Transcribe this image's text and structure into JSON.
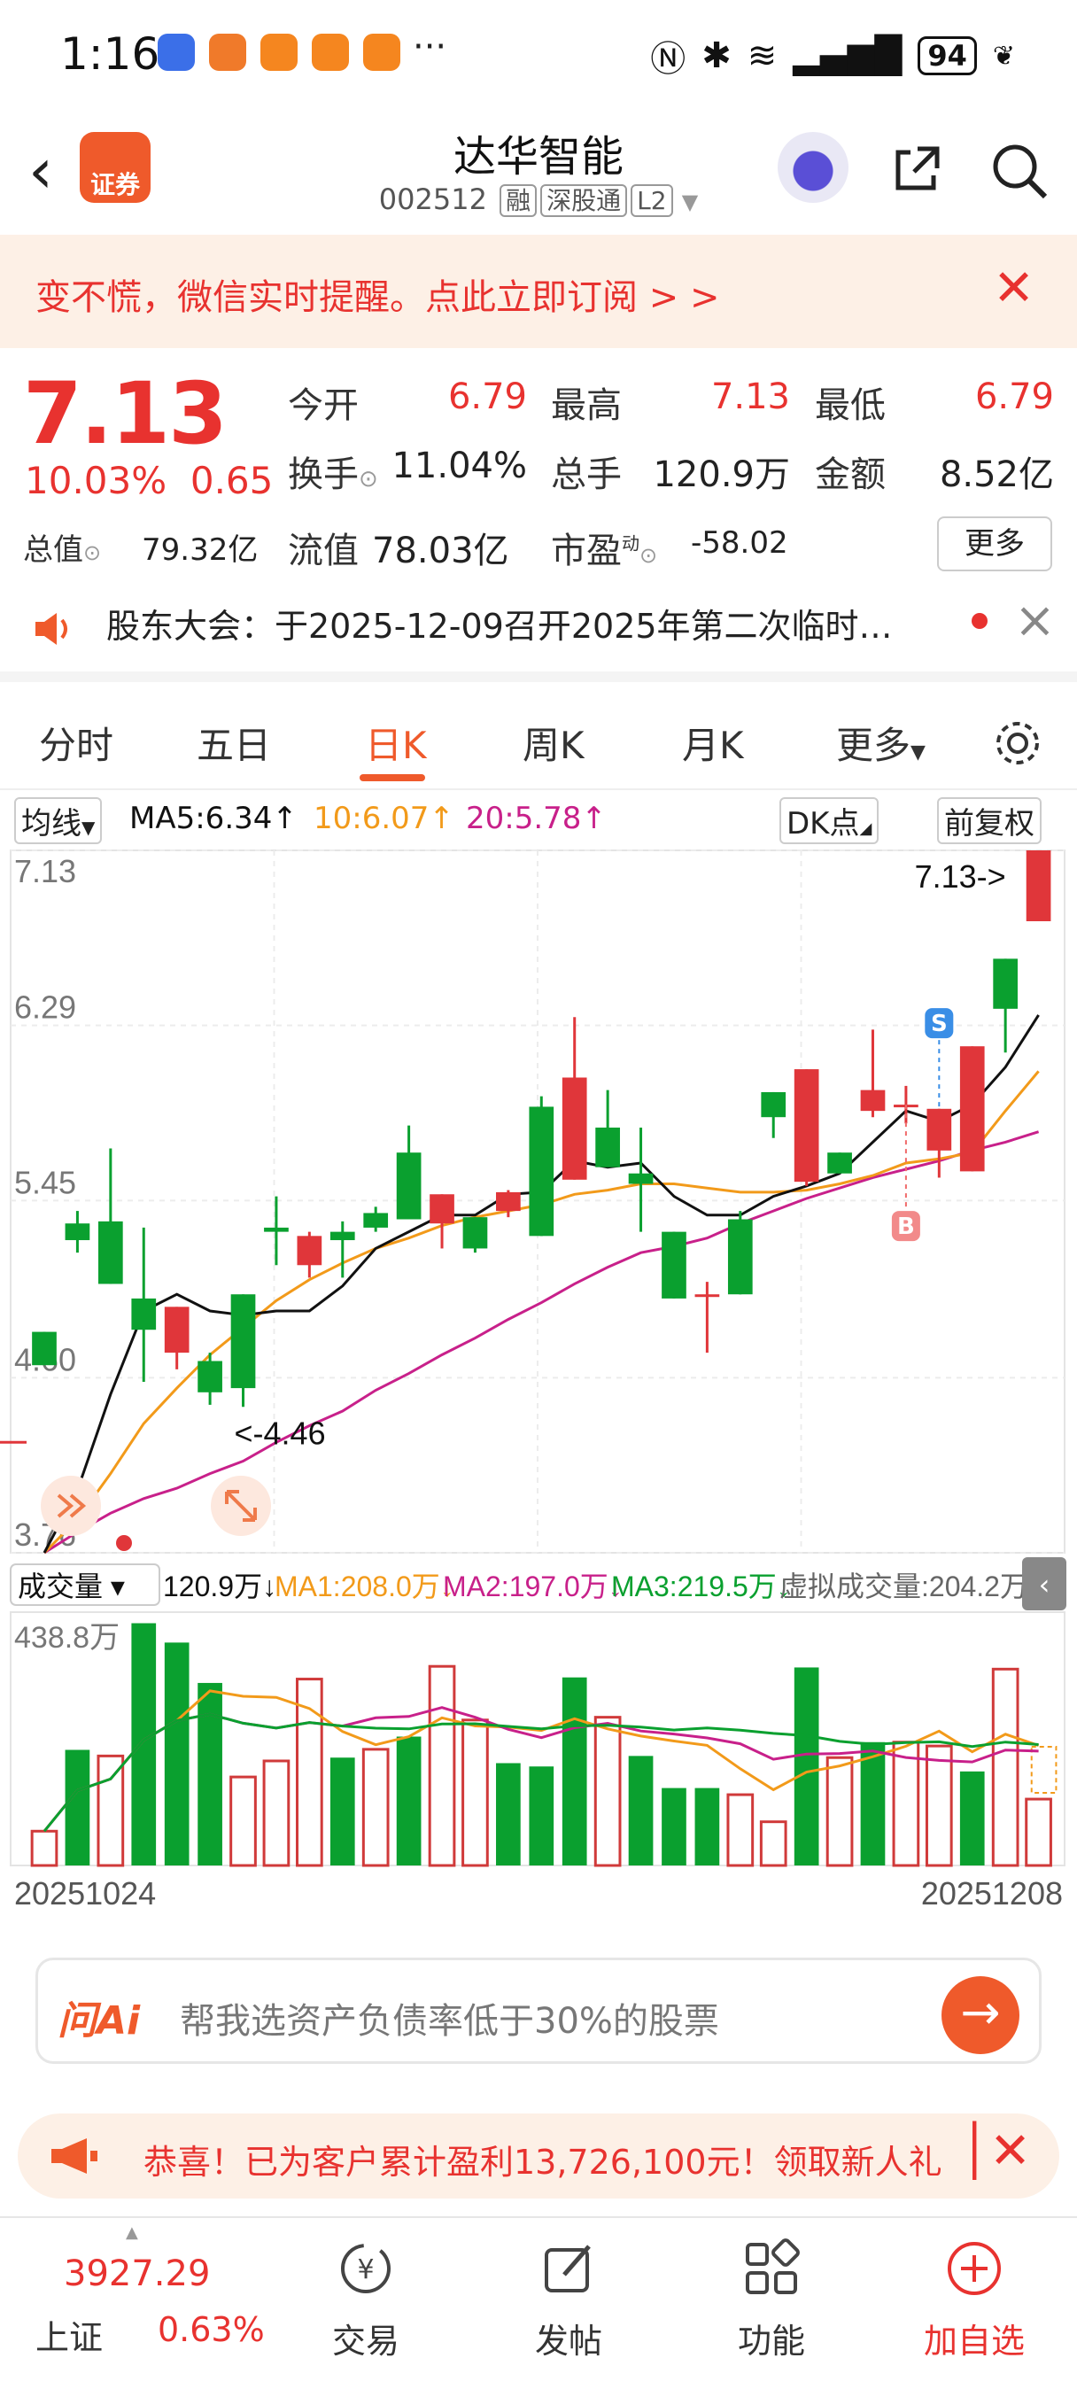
{
  "status_bar": {
    "time": "1:16",
    "battery": "94"
  },
  "header": {
    "logo_text": "证券",
    "stock_name": "达华智能",
    "stock_code": "002512",
    "tags": [
      "融",
      "深股通",
      "L2"
    ]
  },
  "banner": {
    "text": "变不慌，微信实时提醒。点此立即订阅 > >"
  },
  "quote": {
    "price": "7.13",
    "change_pct": "10.03%",
    "change_amt": "0.65",
    "open_label": "今开",
    "open": "6.79",
    "high_label": "最高",
    "high": "7.13",
    "low_label": "最低",
    "low": "6.79",
    "turnover_label": "换手",
    "turnover": "11.04%",
    "volume_label": "总手",
    "volume": "120.9万",
    "amount_label": "金额",
    "amount": "8.52亿",
    "mktcap_label": "总值",
    "mktcap": "79.32亿",
    "float_label": "流值",
    "float_cap": "78.03亿",
    "pe_label": "市盈",
    "pe_sup": "动",
    "pe": "-58.02",
    "more_label": "更多"
  },
  "notice": {
    "text": "股东大会：于2025-12-09召开2025年第二次临时…"
  },
  "tabs": [
    {
      "label": "分时"
    },
    {
      "label": "五日"
    },
    {
      "label": "日K"
    },
    {
      "label": "周K"
    },
    {
      "label": "月K"
    },
    {
      "label": "更多"
    }
  ],
  "active_tab": "日K",
  "ma_bar": {
    "select": "均线",
    "ma5": "MA5:6.34",
    "ma10": "10:6.07",
    "ma20": "20:5.78",
    "dk_label": "DK点",
    "adjust_label": "前复权"
  },
  "chart_data": [
    {
      "type": "candlestick",
      "y_ticks": [
        "7.13",
        "6.29",
        "5.45",
        "4.60",
        "3.76"
      ],
      "ylim": [
        3.76,
        7.13
      ],
      "x_labels": [
        "20251024",
        "20251208"
      ],
      "annotations": {
        "max": "7.13->",
        "min": "<-4.46",
        "sell_marker": "S",
        "buy_marker": "B"
      },
      "candles": [
        {
          "o": 4.82,
          "c": 4.66,
          "h": 4.82,
          "l": 4.66
        },
        {
          "o": 5.34,
          "c": 5.26,
          "h": 5.4,
          "l": 5.2
        },
        {
          "o": 5.35,
          "c": 5.05,
          "h": 5.7,
          "l": 5.05
        },
        {
          "o": 4.98,
          "c": 4.83,
          "h": 5.32,
          "l": 4.58
        },
        {
          "o": 4.72,
          "c": 4.94,
          "h": 4.94,
          "l": 4.64
        },
        {
          "o": 4.68,
          "c": 4.53,
          "h": 4.72,
          "l": 4.47
        },
        {
          "o": 5.0,
          "c": 4.55,
          "h": 5.0,
          "l": 4.46
        },
        {
          "o": 5.32,
          "c": 5.3,
          "h": 5.47,
          "l": 5.14
        },
        {
          "o": 5.14,
          "c": 5.28,
          "h": 5.3,
          "l": 5.08
        },
        {
          "o": 5.3,
          "c": 5.26,
          "h": 5.35,
          "l": 5.08
        },
        {
          "o": 5.39,
          "c": 5.32,
          "h": 5.42,
          "l": 5.3
        },
        {
          "o": 5.68,
          "c": 5.36,
          "h": 5.81,
          "l": 5.36
        },
        {
          "o": 5.34,
          "c": 5.48,
          "h": 5.48,
          "l": 5.22
        },
        {
          "o": 5.37,
          "c": 5.22,
          "h": 5.37,
          "l": 5.2
        },
        {
          "o": 5.4,
          "c": 5.49,
          "h": 5.5,
          "l": 5.37
        },
        {
          "o": 5.9,
          "c": 5.28,
          "h": 5.95,
          "l": 5.28
        },
        {
          "o": 5.55,
          "c": 6.04,
          "h": 6.33,
          "l": 5.55
        },
        {
          "o": 5.8,
          "c": 5.61,
          "h": 5.98,
          "l": 5.61
        },
        {
          "o": 5.58,
          "c": 5.53,
          "h": 5.8,
          "l": 5.3
        },
        {
          "o": 5.3,
          "c": 4.98,
          "h": 5.3,
          "l": 4.98
        },
        {
          "o": 4.99,
          "c": 5.0,
          "h": 5.06,
          "l": 4.72
        },
        {
          "o": 5.36,
          "c": 5.0,
          "h": 5.4,
          "l": 5.0
        },
        {
          "o": 5.97,
          "c": 5.85,
          "h": 5.97,
          "l": 5.75
        },
        {
          "o": 5.54,
          "c": 6.08,
          "h": 6.08,
          "l": 5.52
        },
        {
          "o": 5.68,
          "c": 5.58,
          "h": 5.68,
          "l": 5.58
        },
        {
          "o": 5.88,
          "c": 5.98,
          "h": 6.27,
          "l": 5.85
        },
        {
          "o": 5.91,
          "c": 5.91,
          "h": 6.0,
          "l": 5.82
        },
        {
          "o": 5.69,
          "c": 5.89,
          "h": 5.89,
          "l": 5.56
        },
        {
          "o": 5.59,
          "c": 6.19,
          "h": 6.19,
          "l": 5.59
        },
        {
          "o": 6.61,
          "c": 6.37,
          "h": 6.61,
          "l": 6.16
        },
        {
          "o": 6.79,
          "c": 7.13,
          "h": 7.13,
          "l": 6.79
        }
      ],
      "ma5": [
        3.76,
        4.06,
        4.52,
        4.92,
        5.0,
        4.92,
        4.9,
        4.92,
        4.92,
        5.04,
        5.22,
        5.3,
        5.38,
        5.38,
        5.48,
        5.49,
        5.64,
        5.61,
        5.63,
        5.47,
        5.38,
        5.38,
        5.47,
        5.52,
        5.58,
        5.73,
        5.88,
        5.83,
        5.91,
        6.09,
        6.34
      ],
      "ma10": [
        3.76,
        3.92,
        4.14,
        4.38,
        4.55,
        4.71,
        4.84,
        4.97,
        5.07,
        5.15,
        5.22,
        5.27,
        5.33,
        5.37,
        5.4,
        5.43,
        5.48,
        5.5,
        5.53,
        5.53,
        5.51,
        5.49,
        5.49,
        5.5,
        5.53,
        5.57,
        5.63,
        5.65,
        5.68,
        5.88,
        6.07
      ],
      "ma20": [
        3.76,
        3.86,
        3.95,
        4.02,
        4.07,
        4.14,
        4.2,
        4.29,
        4.37,
        4.44,
        4.54,
        4.62,
        4.71,
        4.79,
        4.88,
        4.96,
        5.05,
        5.13,
        5.2,
        5.23,
        5.27,
        5.34,
        5.4,
        5.46,
        5.51,
        5.56,
        5.6,
        5.64,
        5.69,
        5.73,
        5.78
      ]
    },
    {
      "type": "bar",
      "title": "成交量",
      "current": "120.9万",
      "ma1": "MA1:208.0万",
      "ma2": "MA2:197.0万",
      "ma3": "MA3:219.5万",
      "virtual": "虚拟成交量:204.2万",
      "y_max_label": "438.8万",
      "ylim": [
        0,
        438.8
      ],
      "values": [
        62,
        209,
        198,
        438,
        403,
        330,
        160,
        189,
        337,
        195,
        210,
        233,
        360,
        263,
        185,
        179,
        340,
        268,
        198,
        140,
        140,
        128,
        79,
        358,
        195,
        223,
        223,
        216,
        170,
        355,
        120
      ],
      "rising": [
        1,
        0,
        1,
        0,
        0,
        0,
        1,
        1,
        1,
        0,
        1,
        0,
        1,
        1,
        0,
        0,
        0,
        1,
        0,
        0,
        0,
        1,
        1,
        0,
        1,
        0,
        1,
        1,
        0,
        1,
        1
      ]
    }
  ],
  "ai_box": {
    "logo": "问Ai",
    "placeholder": "帮我选资产负债率低于30%的股票"
  },
  "promo": {
    "text": "恭喜！已为客户累计盈利13,726,100元！领取新人礼"
  },
  "bottom_nav": {
    "index_value": "3927.29",
    "index_name": "上证",
    "index_change": "0.63%",
    "items": [
      {
        "label": "交易"
      },
      {
        "label": "发帖"
      },
      {
        "label": "功能"
      },
      {
        "label": "加自选"
      }
    ]
  }
}
